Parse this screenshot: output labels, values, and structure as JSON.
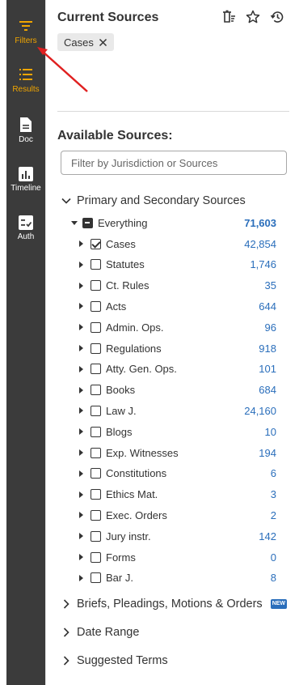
{
  "sidebar": {
    "items": [
      {
        "label": "Filters",
        "icon": "filter-icon"
      },
      {
        "label": "Results",
        "icon": "list-icon"
      },
      {
        "label": "Doc",
        "icon": "document-icon"
      },
      {
        "label": "Timeline",
        "icon": "bar-chart-icon"
      },
      {
        "label": "Auth",
        "icon": "checklist-icon"
      }
    ]
  },
  "current_sources": {
    "title": "Current Sources",
    "chip_label": "Cases"
  },
  "available": {
    "title": "Available Sources:",
    "filter_placeholder": "Filter by Jurisdiction or Sources"
  },
  "sections": {
    "primary": "Primary and Secondary Sources",
    "briefs": "Briefs, Pleadings, Motions & Orders",
    "briefs_badge": "NEW",
    "date_range": "Date Range",
    "suggested": "Suggested Terms"
  },
  "tree": {
    "everything": {
      "label": "Everything",
      "count": "71,603"
    },
    "items": [
      {
        "label": "Cases",
        "count": "42,854",
        "checked": true
      },
      {
        "label": "Statutes",
        "count": "1,746",
        "checked": false
      },
      {
        "label": "Ct. Rules",
        "count": "35",
        "checked": false
      },
      {
        "label": "Acts",
        "count": "644",
        "checked": false
      },
      {
        "label": "Admin. Ops.",
        "count": "96",
        "checked": false
      },
      {
        "label": "Regulations",
        "count": "918",
        "checked": false
      },
      {
        "label": "Atty. Gen. Ops.",
        "count": "101",
        "checked": false
      },
      {
        "label": "Books",
        "count": "684",
        "checked": false
      },
      {
        "label": "Law J.",
        "count": "24,160",
        "checked": false
      },
      {
        "label": "Blogs",
        "count": "10",
        "checked": false
      },
      {
        "label": "Exp. Witnesses",
        "count": "194",
        "checked": false
      },
      {
        "label": "Constitutions",
        "count": "6",
        "checked": false
      },
      {
        "label": "Ethics Mat.",
        "count": "3",
        "checked": false
      },
      {
        "label": "Exec. Orders",
        "count": "2",
        "checked": false
      },
      {
        "label": "Jury instr.",
        "count": "142",
        "checked": false
      },
      {
        "label": "Forms",
        "count": "0",
        "checked": false
      },
      {
        "label": "Bar J.",
        "count": "8",
        "checked": false
      }
    ]
  },
  "colors": {
    "accent": "#f0a500",
    "sidebar_bg": "#3b3b3b",
    "link_blue": "#2a6ebb",
    "annotation_arrow": "#e02020"
  }
}
